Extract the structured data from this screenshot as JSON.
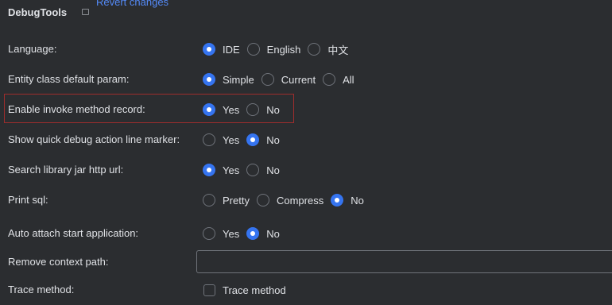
{
  "header": {
    "title": "DebugTools",
    "revert_link": "Revert changes"
  },
  "settings": {
    "language": {
      "label": "Language:",
      "options": [
        "IDE",
        "English",
        "中文"
      ],
      "selected": "IDE"
    },
    "entity_param": {
      "label": "Entity class default param:",
      "options": [
        "Simple",
        "Current",
        "All"
      ],
      "selected": "Simple"
    },
    "invoke_record": {
      "label": "Enable invoke method record:",
      "options": [
        "Yes",
        "No"
      ],
      "selected": "Yes"
    },
    "line_marker": {
      "label": "Show quick debug action line marker:",
      "options": [
        "Yes",
        "No"
      ],
      "selected": "No"
    },
    "library_jar": {
      "label": "Search library jar http url:",
      "options": [
        "Yes",
        "No"
      ],
      "selected": "Yes"
    },
    "print_sql": {
      "label": "Print sql:",
      "options": [
        "Pretty",
        "Compress",
        "No"
      ],
      "selected": "No"
    },
    "auto_attach": {
      "label": "Auto attach start application:",
      "options": [
        "Yes",
        "No"
      ],
      "selected": "No"
    },
    "context_path": {
      "label": "Remove context path:",
      "value": ""
    },
    "trace_method": {
      "label": "Trace method:",
      "checkbox_label": "Trace method",
      "checked": false
    }
  },
  "colors": {
    "background": "#2b2d30",
    "text": "#dfe1e5",
    "link": "#548af7",
    "radio_selected": "#3574f0",
    "highlight_border": "#9e2d2d"
  }
}
